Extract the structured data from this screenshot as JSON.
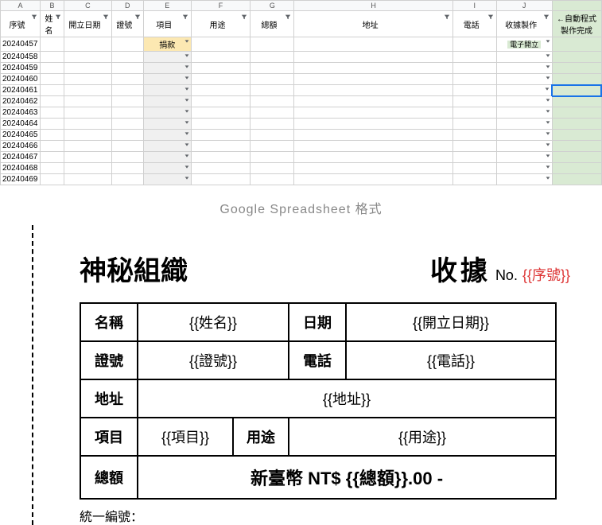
{
  "spreadsheet": {
    "col_letters": [
      "A",
      "B",
      "C",
      "D",
      "E",
      "F",
      "G",
      "H",
      "I",
      "J",
      ""
    ],
    "headers": [
      "序號",
      "姓名",
      "開立日期",
      "證號",
      "項目",
      "用途",
      "總額",
      "地址",
      "電話",
      "收據製作",
      "←自動程式製作完成"
    ],
    "rows": [
      {
        "seq": "20240457",
        "item": "捐款",
        "receipt": "電子開立"
      },
      {
        "seq": "20240458",
        "item": "",
        "receipt": ""
      },
      {
        "seq": "20240459",
        "item": "",
        "receipt": ""
      },
      {
        "seq": "20240460",
        "item": "",
        "receipt": ""
      },
      {
        "seq": "20240461",
        "item": "",
        "receipt": ""
      },
      {
        "seq": "20240462",
        "item": "",
        "receipt": ""
      },
      {
        "seq": "20240463",
        "item": "",
        "receipt": ""
      },
      {
        "seq": "20240464",
        "item": "",
        "receipt": ""
      },
      {
        "seq": "20240465",
        "item": "",
        "receipt": ""
      },
      {
        "seq": "20240466",
        "item": "",
        "receipt": ""
      },
      {
        "seq": "20240467",
        "item": "",
        "receipt": ""
      },
      {
        "seq": "20240468",
        "item": "",
        "receipt": ""
      },
      {
        "seq": "20240469",
        "item": "",
        "receipt": ""
      }
    ]
  },
  "caption": "Google Spreadsheet 格式",
  "receipt": {
    "org": "神秘組織",
    "title": "收據",
    "no_label": "No.",
    "no_var": "{{序號}}",
    "labels": {
      "name": "名稱",
      "date": "日期",
      "id": "證號",
      "phone": "電話",
      "addr": "地址",
      "item": "項目",
      "use": "用途",
      "total": "總額"
    },
    "vars": {
      "name": "{{姓名}}",
      "date": "{{開立日期}}",
      "id": "{{證號}}",
      "phone": "{{電話}}",
      "addr": "{{地址}}",
      "item": "{{項目}}",
      "use": "{{用途}}"
    },
    "total_text": "新臺幣 NT$ {{總額}}.00 -",
    "footer": "統一編號："
  }
}
